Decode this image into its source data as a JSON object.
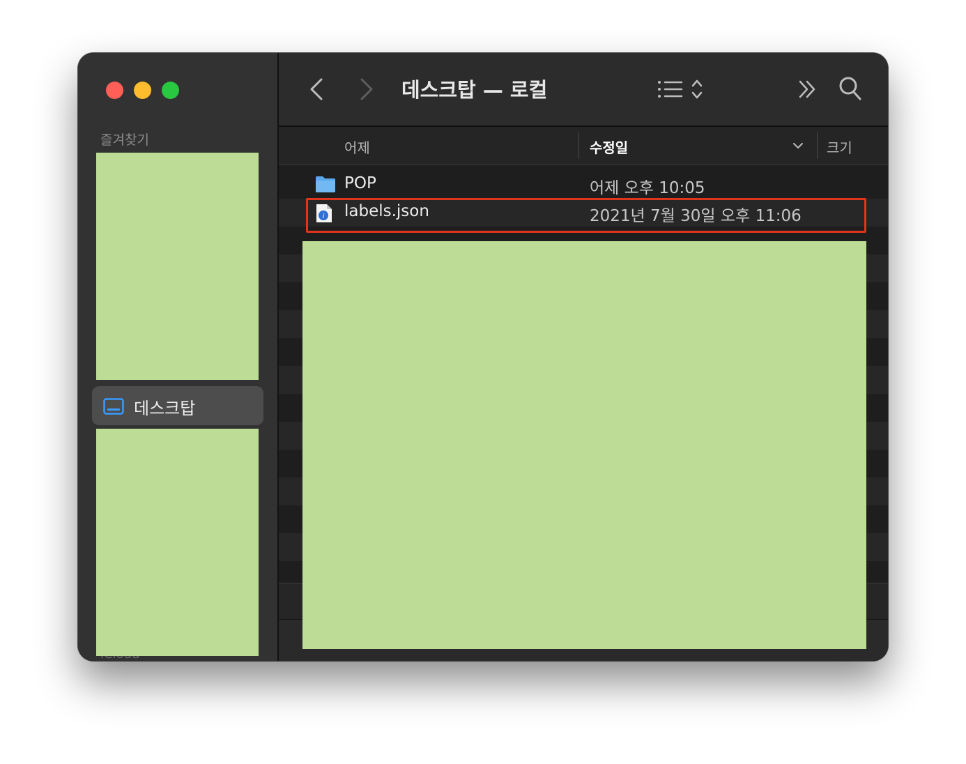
{
  "window": {
    "title": "데스크탑 — 로컬"
  },
  "sidebar": {
    "section_label": "즐겨찾기",
    "selected_item": {
      "label": "데스크탑",
      "icon": "desktop-icon"
    },
    "ghost_text": "iCloud"
  },
  "toolbar": {
    "back_icon": "chevron-left-icon",
    "forward_icon": "chevron-right-icon",
    "view_icon": "list-view-icon",
    "more_icon": "double-chevron-right-icon",
    "search_icon": "search-icon"
  },
  "columns": {
    "name": "어제",
    "modified": "수정일",
    "size": "크기",
    "sort_icon": "chevron-down-icon"
  },
  "files": [
    {
      "name": "POP",
      "modified": "어제 오후 10:05",
      "icon": "folder-icon"
    },
    {
      "name": "labels.json",
      "modified": "2021년 7월 30일 오후 11:06",
      "icon": "json-file-icon"
    }
  ],
  "colors": {
    "highlight_border": "#e0341c",
    "redaction_fill": "#bddc95",
    "folder_blue": "#5aa9ee",
    "traffic_red": "#ff5f57",
    "traffic_yellow": "#febc2e",
    "traffic_green": "#28c840"
  }
}
